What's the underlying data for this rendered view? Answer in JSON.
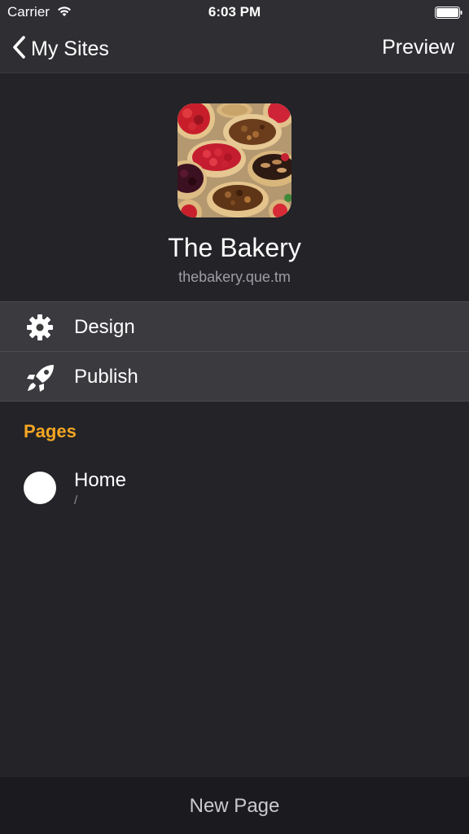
{
  "status_bar": {
    "carrier": "Carrier",
    "time": "6:03 PM",
    "wifi_icon": "wifi-icon",
    "battery_icon": "battery-icon"
  },
  "nav": {
    "back_label": "My Sites",
    "back_icon": "chevron-left-icon",
    "preview_label": "Preview"
  },
  "site": {
    "title": "The Bakery",
    "url": "thebakery.que.tm",
    "thumbnail": "bakery-tarts-image"
  },
  "menu": [
    {
      "label": "Design",
      "icon": "gear-icon"
    },
    {
      "label": "Publish",
      "icon": "rocket-icon"
    }
  ],
  "pages_section": {
    "title": "Pages",
    "items": [
      {
        "name": "Home",
        "path": "/"
      }
    ]
  },
  "bottom_bar": {
    "new_page_label": "New Page"
  },
  "colors": {
    "background": "#232328",
    "nav_background": "#2e2e33",
    "row_background": "#3a3a3f",
    "accent": "#f5a623",
    "bottom_bar": "#1b1b1f"
  }
}
